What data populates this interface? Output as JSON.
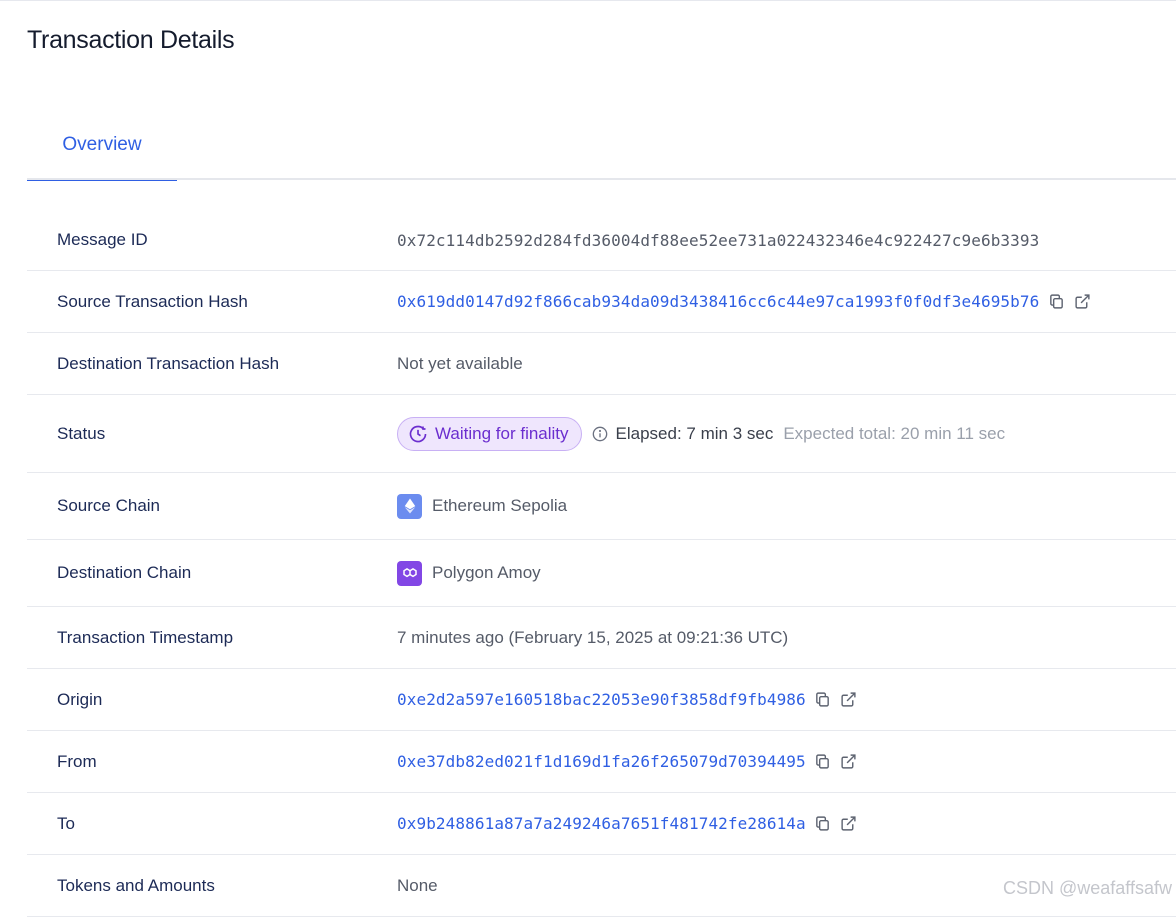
{
  "page": {
    "title": "Transaction Details"
  },
  "tabs": [
    {
      "label": "Overview"
    }
  ],
  "details": {
    "message_id": {
      "label": "Message ID",
      "value": "0x72c114db2592d284fd36004df88ee52ee731a022432346e4c922427c9e6b3393"
    },
    "source_tx_hash": {
      "label": "Source Transaction Hash",
      "value": "0x619dd0147d92f866cab934da09d3438416cc6c44e97ca1993f0f0df3e4695b76"
    },
    "dest_tx_hash": {
      "label": "Destination Transaction Hash",
      "value": "Not yet available"
    },
    "status": {
      "label": "Status",
      "badge": "Waiting for finality",
      "elapsed": "Elapsed: 7 min 3 sec",
      "expected": "Expected total: 20 min 11 sec",
      "badge_color": "#6b2ecf"
    },
    "source_chain": {
      "label": "Source Chain",
      "value": "Ethereum Sepolia",
      "icon": "ethereum-icon"
    },
    "dest_chain": {
      "label": "Destination Chain",
      "value": "Polygon Amoy",
      "icon": "polygon-icon"
    },
    "timestamp": {
      "label": "Transaction Timestamp",
      "value": "7 minutes ago (February 15, 2025 at 09:21:36 UTC)"
    },
    "origin": {
      "label": "Origin",
      "value": "0xe2d2a597e160518bac22053e90f3858df9fb4986"
    },
    "from": {
      "label": "From",
      "value": "0xe37db82ed021f1d169d1fa26f265079d70394495"
    },
    "to": {
      "label": "To",
      "value": "0x9b248861a87a7a249246a7651f481742fe28614a"
    },
    "tokens": {
      "label": "Tokens and Amounts",
      "value": "None"
    }
  },
  "colors": {
    "link": "#2f5fe3",
    "label": "#1c2a56",
    "muted": "#9aa0ab"
  },
  "watermark": "CSDN @weafaffsafw"
}
